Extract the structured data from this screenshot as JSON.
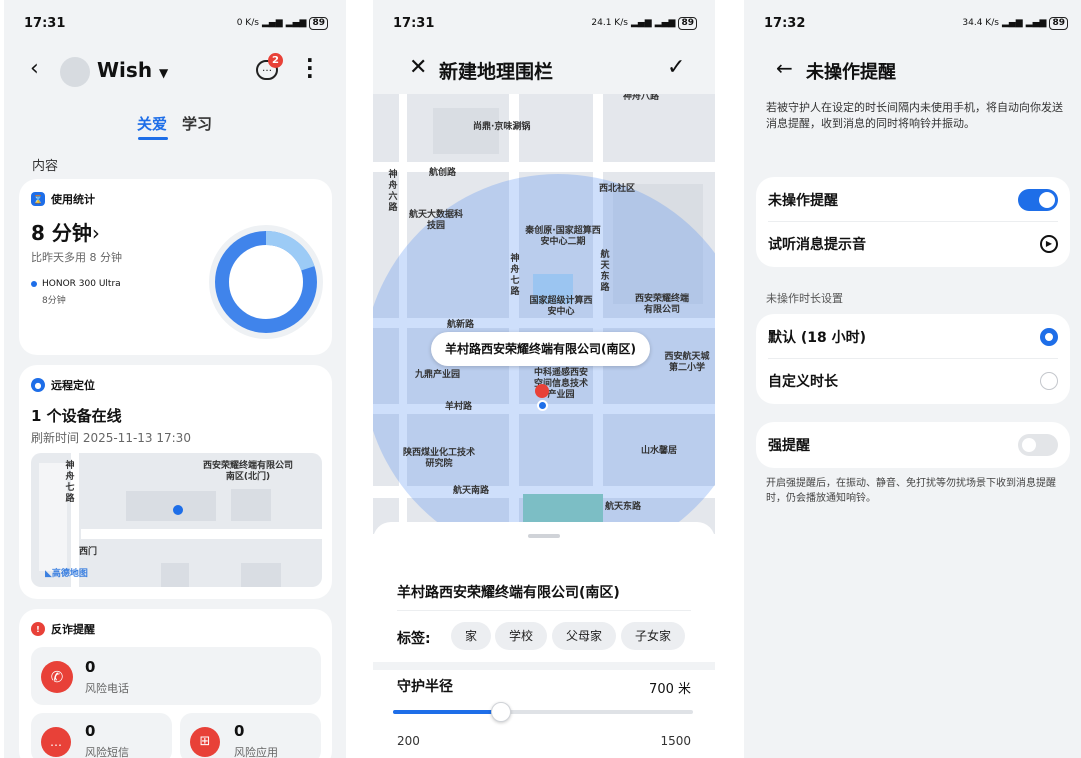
{
  "panel1": {
    "status": {
      "time": "17:31",
      "speed": "0 K/s",
      "net1": "5G",
      "net2": "5G",
      "battery": "89"
    },
    "header": {
      "name": "Wish",
      "badge": "2"
    },
    "tabs": [
      "关爱",
      "学习"
    ],
    "section_label": "内容",
    "usage": {
      "title": "使用统计",
      "value": "8 分钟",
      "compare": "比昨天多用 8 分钟",
      "device": "HONOR 300 Ultra",
      "device_time": "8分钟"
    },
    "location": {
      "title": "远程定位",
      "online": "1 个设备在线",
      "refresh": "刷新时间 2025-11-13 17:30",
      "map_labels": {
        "road": "神舟七路",
        "company": "西安荣耀终端有限公司南区(北门)",
        "gate": "西门",
        "brand": "高德地图"
      }
    },
    "fraud": {
      "title": "反诈提醒",
      "calls_count": "0",
      "calls_label": "风险电话",
      "sms_count": "0",
      "sms_label": "风险短信",
      "apps_count": "0",
      "apps_label": "风险应用"
    }
  },
  "panel2": {
    "status": {
      "time": "17:31",
      "speed": "24.1 K/s",
      "net1": "5G",
      "net2": "5G",
      "battery": "89"
    },
    "header": {
      "title": "新建地理围栏"
    },
    "map_labels": {
      "shenzhou8": "神舟八路",
      "hotpot": "尚鼎·京味涮锅",
      "hangchuang": "航创路",
      "xibei": "西北社区",
      "shenzhou6": "神舟六路",
      "hangtian_data": "航天大数据科技园",
      "qinchuangyuan": "秦创原·国家超算西安中心二期",
      "shenzhou7": "神舟七路",
      "hangtian_east": "航天东路",
      "national_center": "国家超级计算西安中心",
      "honor_co": "西安荣耀终端有限公司",
      "hangxin": "航新路",
      "xian_hangtian_school": "西安航天城第二小学",
      "jiuding": "九鼎产业园",
      "zhongke": "中科遥感西安空间信息技术产业园",
      "yangcun": "羊村路",
      "coal": "陕西煤业化工技术研究院",
      "shanshui": "山水馨居",
      "hangtian_south": "航天南路",
      "hangtian_east2": "航天东路"
    },
    "callout": "羊村路西安荣耀终端有限公司(南区)",
    "sheet": {
      "place": "羊村路西安荣耀终端有限公司(南区)",
      "tags_label": "标签:",
      "tags": [
        "家",
        "学校",
        "父母家",
        "子女家"
      ],
      "radius_label": "守护半径",
      "radius_value": "700 米",
      "radius_fraction": 0.36,
      "min": "200",
      "max": "1500"
    }
  },
  "panel3": {
    "status": {
      "time": "17:32",
      "speed": "34.4 K/s",
      "net1": "5G",
      "net2": "5G",
      "battery": "89"
    },
    "header": {
      "title": "未操作提醒"
    },
    "desc": "若被守护人在设定的时长间隔内未使用手机，将自动向你发送消息提醒，收到消息的同时将响铃并振动。",
    "toggle_label": "未操作提醒",
    "sound_label": "试听消息提示音",
    "duration_section": "未操作时长设置",
    "option_default": "默认 (18 小时)",
    "option_custom": "自定义时长",
    "strong_label": "强提醒",
    "strong_desc": "开启强提醒后，在振动、静音、免打扰等勿扰场景下收到消息提醒时，仍会播放通知响铃。"
  }
}
